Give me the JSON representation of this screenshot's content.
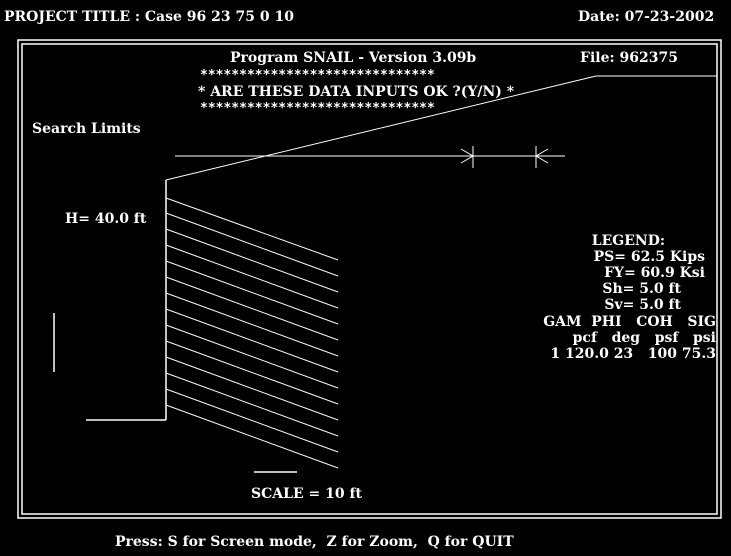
{
  "header": {
    "project_title": "PROJECT TITLE : Case 96 23 75 0 10",
    "date": "Date: 07-23-2002"
  },
  "program": {
    "title": "Program SNAIL - Version 3.09b",
    "file": "File: 962375",
    "stars_line": "******************************",
    "prompt": "* ARE THESE DATA INPUTS OK ?(Y/N) *"
  },
  "labels": {
    "search_limits": "Search Limits",
    "height": "H= 40.0 ft",
    "scale": "SCALE = 10 ft"
  },
  "legend": {
    "title": "LEGEND:",
    "ps": "PS= 62.5 Kips",
    "fy": "FY= 60.9 Ksi",
    "sh": "Sh= 5.0 ft",
    "sv": "Sv= 5.0 ft",
    "col_header1": "GAM  PHI   COH   SIG",
    "col_header2": "pcf   deg   psf   psi",
    "row1": "1 120.0 23   100 75.3"
  },
  "footer": {
    "instructions": "Press: S for Screen mode,  Z for Zoom,  Q for QUIT"
  },
  "colors": {
    "background": "#000000",
    "foreground": "#ffffff"
  }
}
